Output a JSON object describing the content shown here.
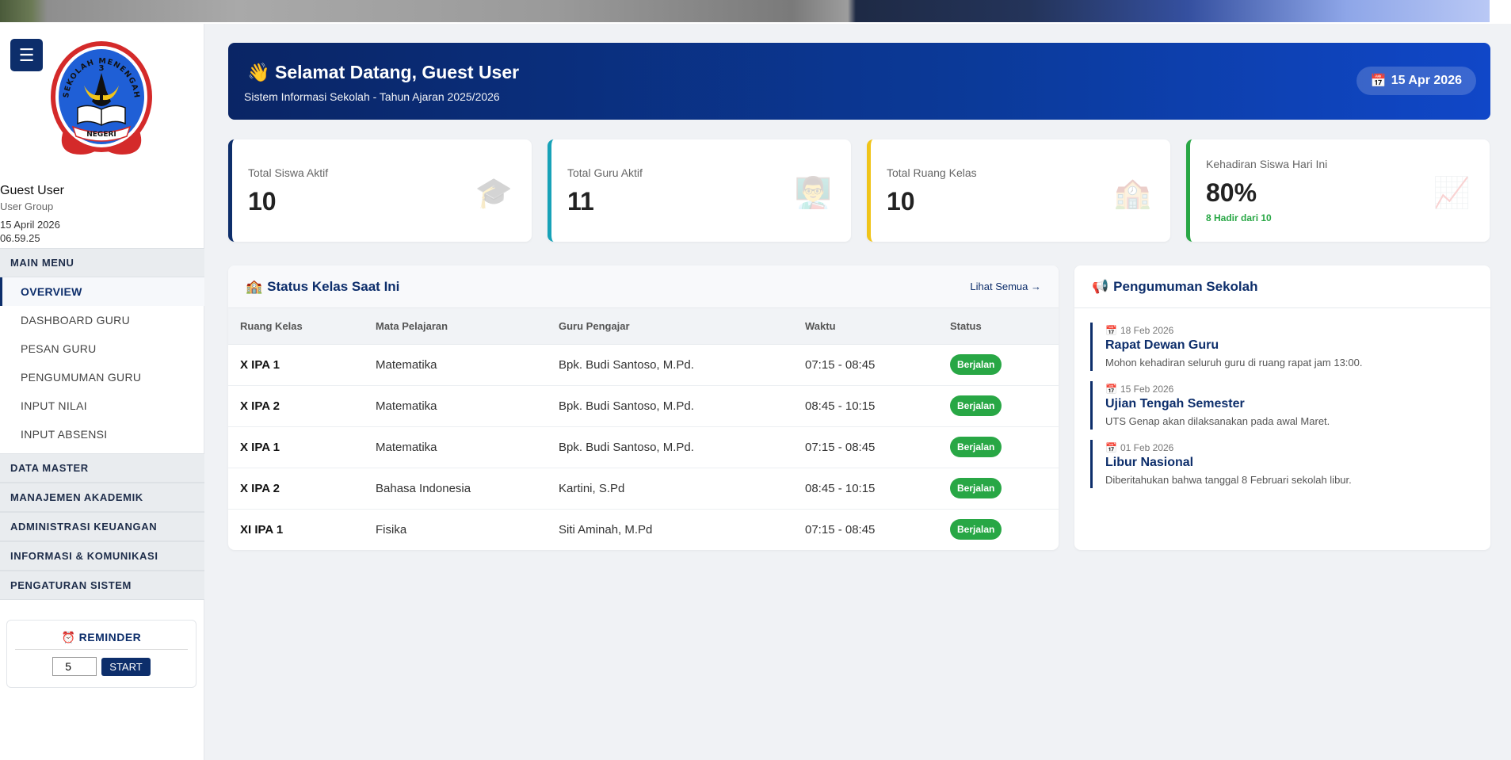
{
  "sidebar": {
    "menu_toggle_icon": "hamburger-icon",
    "logo_text": {
      "arc": "SEKOLAH MENENGAH ATAS",
      "number": "3",
      "ribbon": "NEGERI"
    },
    "user": {
      "name": "Guest User",
      "group": "User Group",
      "date": "15 April 2026",
      "time": "06.59.25"
    },
    "main_menu_label": "MAIN MENU",
    "main_items": [
      {
        "label": "OVERVIEW",
        "active": true
      },
      {
        "label": "DASHBOARD GURU"
      },
      {
        "label": "PESAN GURU"
      },
      {
        "label": "PENGUMUMAN GURU"
      },
      {
        "label": "INPUT NILAI"
      },
      {
        "label": "INPUT ABSENSI"
      }
    ],
    "sections": [
      "DATA MASTER",
      "MANAJEMEN AKADEMIK",
      "ADMINISTRASI KEUANGAN",
      "INFORMASI & KOMUNIKASI",
      "PENGATURAN SISTEM"
    ],
    "reminder": {
      "icon": "⏰",
      "title": "REMINDER",
      "value": "5",
      "button": "START"
    }
  },
  "welcome": {
    "icon": "👋",
    "title": "Selamat Datang, Guest User",
    "subtitle": "Sistem Informasi Sekolah - Tahun Ajaran 2025/2026",
    "date_icon": "📅",
    "date": "15 Apr 2026"
  },
  "stats": [
    {
      "label": "Total Siswa Aktif",
      "value": "10",
      "icon": "🎓",
      "color": "#0d2e6b"
    },
    {
      "label": "Total Guru Aktif",
      "value": "11",
      "icon": "👨‍🏫",
      "color": "#17a2b8"
    },
    {
      "label": "Total Ruang Kelas",
      "value": "10",
      "icon": "🏫",
      "color": "#f0c419"
    },
    {
      "label": "Kehadiran Siswa Hari Ini",
      "value": "80%",
      "sub": "8 Hadir dari 10",
      "icon": "📈",
      "color": "#28a745"
    }
  ],
  "status_kelas": {
    "icon": "🏫",
    "title": "Status Kelas Saat Ini",
    "link": "Lihat Semua →",
    "columns": [
      "Ruang Kelas",
      "Mata Pelajaran",
      "Guru Pengajar",
      "Waktu",
      "Status"
    ],
    "rows": [
      [
        "X IPA 1",
        "Matematika",
        "Bpk. Budi Santoso, M.Pd.",
        "07:15 - 08:45",
        "Berjalan"
      ],
      [
        "X IPA 2",
        "Matematika",
        "Bpk. Budi Santoso, M.Pd.",
        "08:45 - 10:15",
        "Berjalan"
      ],
      [
        "X IPA 1",
        "Matematika",
        "Bpk. Budi Santoso, M.Pd.",
        "07:15 - 08:45",
        "Berjalan"
      ],
      [
        "X IPA 2",
        "Bahasa Indonesia",
        "Kartini, S.Pd",
        "08:45 - 10:15",
        "Berjalan"
      ],
      [
        "XI IPA 1",
        "Fisika",
        "Siti Aminah, M.Pd",
        "07:15 - 08:45",
        "Berjalan"
      ]
    ]
  },
  "pengumuman": {
    "icon": "📢",
    "title": "Pengumuman Sekolah",
    "items": [
      {
        "date": "18 Feb 2026",
        "title": "Rapat Dewan Guru",
        "desc": "Mohon kehadiran seluruh guru di ruang rapat jam 13:00."
      },
      {
        "date": "15 Feb 2026",
        "title": "Ujian Tengah Semester",
        "desc": "UTS Genap akan dilaksanakan pada awal Maret."
      },
      {
        "date": "01 Feb 2026",
        "title": "Libur Nasional",
        "desc": "Diberitahukan bahwa tanggal 8 Februari sekolah libur."
      }
    ]
  }
}
